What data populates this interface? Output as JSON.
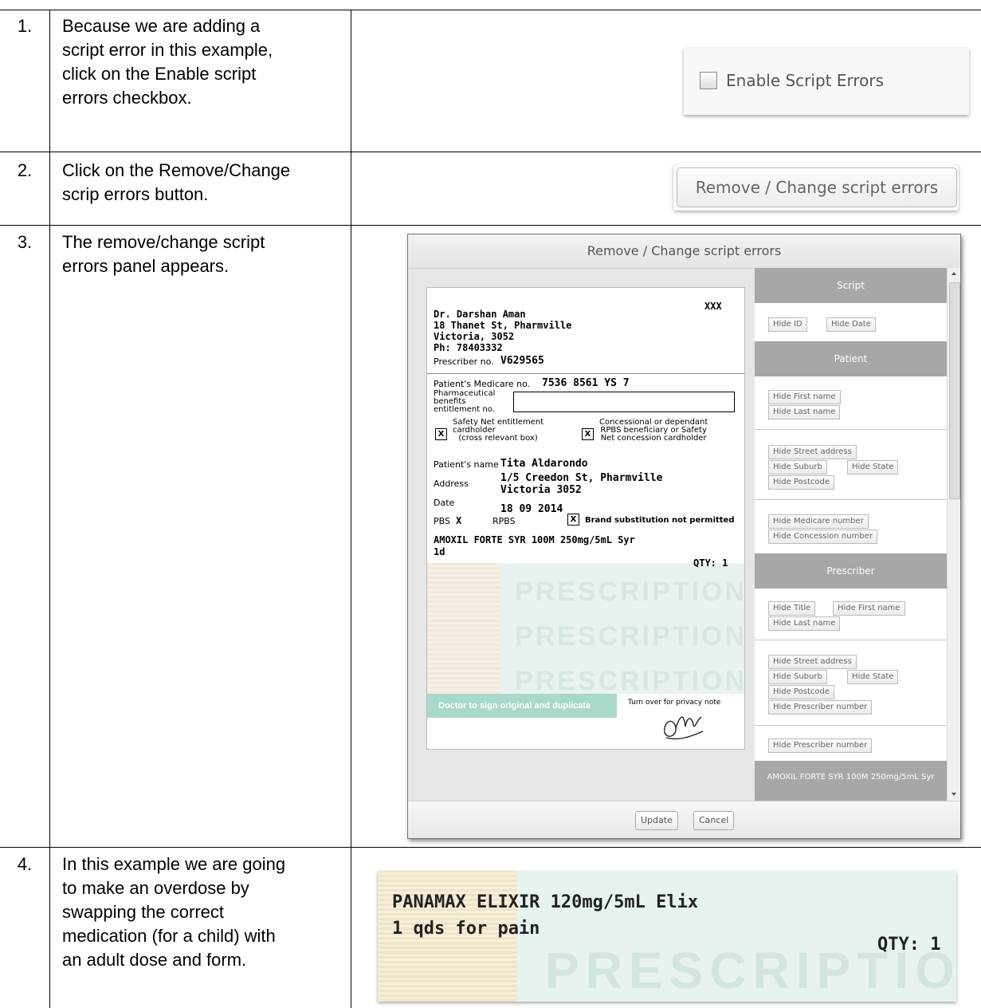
{
  "steps": [
    {
      "number": "1.",
      "lines": [
        "Because we are adding a",
        "script error in this example,",
        "click on the Enable script",
        "errors checkbox."
      ]
    },
    {
      "number": "2.",
      "lines": [
        "Click on the Remove/Change",
        "scrip errors button."
      ]
    },
    {
      "number": "3.",
      "lines": [
        "The remove/change script",
        "errors panel appears."
      ]
    },
    {
      "number": "4.",
      "lines": [
        "In this example we are going",
        "to make an overdose by",
        "swapping the correct",
        "medication (for a child) with",
        "an adult dose and form."
      ]
    }
  ],
  "step1_ui": {
    "checkbox_label": "Enable Script Errors",
    "checked": false
  },
  "step2_ui": {
    "button_label": "Remove / Change script errors"
  },
  "panel": {
    "title": "Remove / Change script errors",
    "update_label": "Update",
    "cancel_label": "Cancel",
    "script": {
      "corner_code": "XXX",
      "doctor": "Dr. Darshan Aman",
      "address1": "18 Thanet St, Pharmville",
      "address2": "Victoria, 3052",
      "phone": "Ph: 78403332",
      "prescriber_label": "Prescriber no.",
      "prescriber_no": "V629565",
      "medicare_label": "Patient's Medicare no.",
      "medicare_no": "7536 8561 YS 7",
      "pbe_label1": "Pharmaceutical",
      "pbe_label2": "benefits",
      "pbe_label3": "entitlement no.",
      "safety1": "Safety Net entitlement",
      "safety2": "cardholder",
      "safety3": "(cross relevant box)",
      "concession1": "Concessional or dependant",
      "concession2": "RPBS beneficiary or Safety",
      "concession3": "Net concession cardholder",
      "patient_name_label": "Patient's name",
      "patient_name": "Tita Aldarondo",
      "address_label": "Address",
      "patient_addr1": "1/5 Creedon St, Pharmville",
      "patient_addr2": "Victoria 3052",
      "date_label": "Date",
      "date": "18 09 2014",
      "pbs_label": "PBS",
      "pbs_mark": "X",
      "rpbs_label": "RPBS",
      "brand_label": "Brand substitution not permitted",
      "mark": "X",
      "drug": "AMOXIL FORTE SYR 100M 250mg/5mL Syr",
      "dose": "1d",
      "qty": "QTY: 1",
      "watermark": "PRESCRIPTION",
      "sign_note": "Doctor to sign original and duplicate",
      "turn_over": "Turn over for privacy note"
    },
    "sections": {
      "script": "Script",
      "patient": "Patient",
      "prescriber": "Prescriber",
      "drug": "AMOXIL FORTE SYR 100M 250mg/5mL Syr"
    },
    "buttons": {
      "hide_id": "Hide ID",
      "hide_date": "Hide Date",
      "hide_first_name": "Hide First name",
      "hide_last_name": "Hide Last name",
      "hide_street": "Hide Street address",
      "hide_suburb": "Hide Suburb",
      "hide_state": "Hide State",
      "hide_postcode": "Hide Postcode",
      "hide_medicare": "Hide Medicare number",
      "hide_concession": "Hide Concession number",
      "hide_title": "Hide Title",
      "hide_prescriber_number": "Hide Prescriber number"
    }
  },
  "step4_ui": {
    "drug": "PANAMAX ELIXIR 120mg/5mL Elix",
    "dose": "1 qds for pain",
    "qty": "QTY: 1",
    "watermark": "PRESCRIPTION"
  }
}
